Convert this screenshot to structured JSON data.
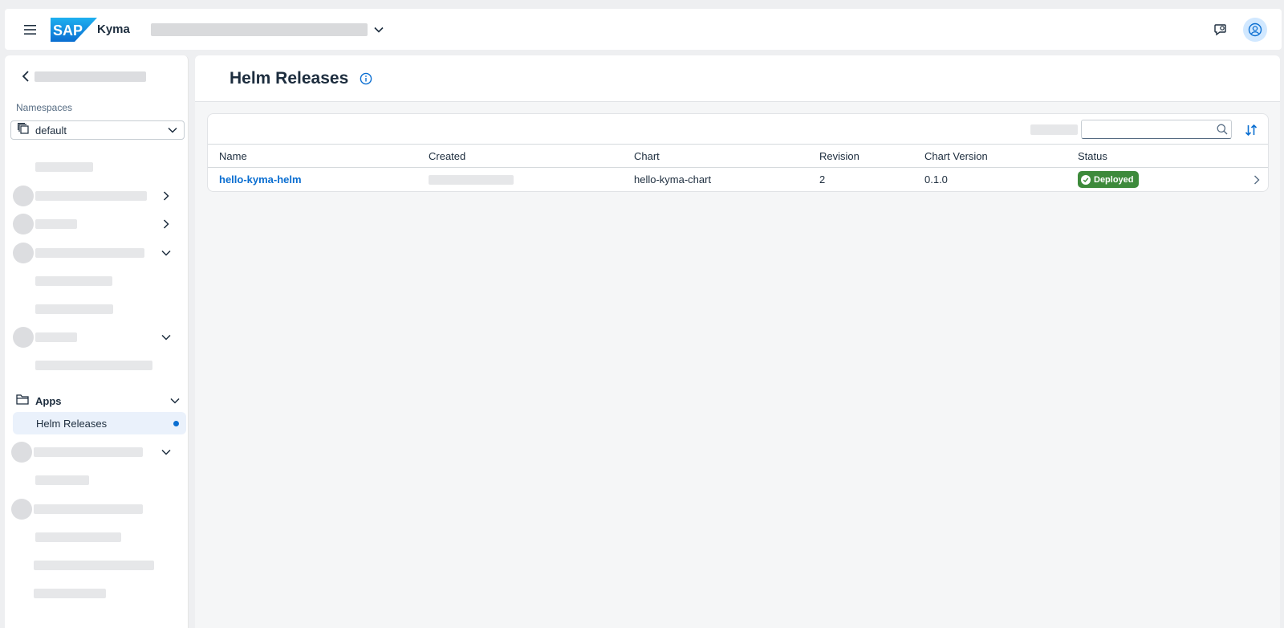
{
  "shell": {
    "product_name": "Kyma",
    "logo_text": "SAP",
    "logo_color": "#0a6ed1"
  },
  "sidebar": {
    "namespaces_label": "Namespaces",
    "namespace_selected": "default",
    "apps_group_label": "Apps",
    "active_item_label": "Helm Releases"
  },
  "page": {
    "title": "Helm Releases"
  },
  "search": {
    "placeholder": ""
  },
  "table": {
    "headers": {
      "name": "Name",
      "created": "Created",
      "chart": "Chart",
      "revision": "Revision",
      "chart_version": "Chart Version",
      "status": "Status"
    },
    "rows": [
      {
        "name": "hello-kyma-helm",
        "chart": "hello-kyma-chart",
        "revision": "2",
        "chart_version": "0.1.0",
        "status": "Deployed"
      }
    ]
  },
  "colors": {
    "accent": "#0a6ed1",
    "status_deployed": "#3d8a3b",
    "active_nav_bg": "#eaf1fb"
  }
}
